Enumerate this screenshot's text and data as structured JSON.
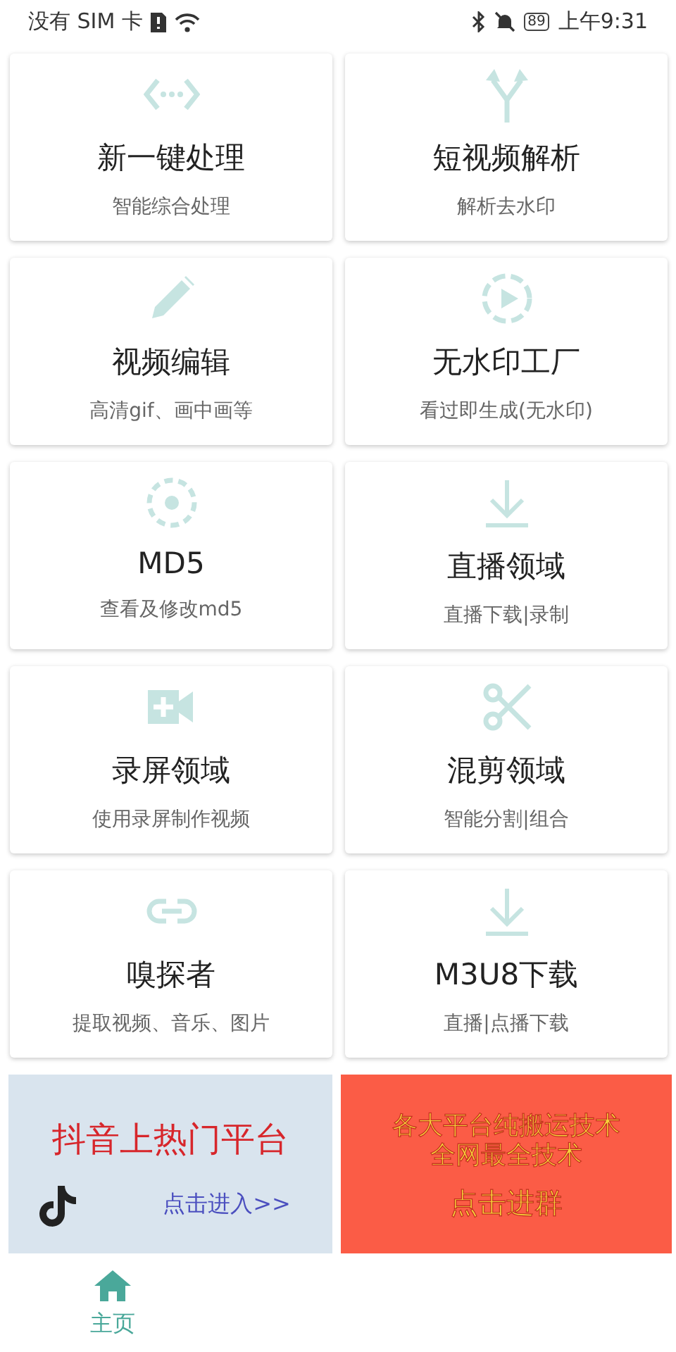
{
  "status_bar": {
    "carrier": "没有 SIM 卡",
    "battery": "89",
    "time": "上午9:31"
  },
  "tools": [
    {
      "title": "新一键处理",
      "subtitle": "智能综合处理"
    },
    {
      "title": "短视频解析",
      "subtitle": "解析去水印"
    },
    {
      "title": "视频编辑",
      "subtitle": "高清gif、画中画等"
    },
    {
      "title": "无水印工厂",
      "subtitle": "看过即生成(无水印)"
    },
    {
      "title": "MD5",
      "subtitle": "查看及修改md5"
    },
    {
      "title": "直播领域",
      "subtitle": "直播下载|录制"
    },
    {
      "title": "录屏领域",
      "subtitle": "使用录屏制作视频"
    },
    {
      "title": "混剪领域",
      "subtitle": "智能分割|组合"
    },
    {
      "title": "嗅探者",
      "subtitle": "提取视频、音乐、图片"
    },
    {
      "title": "M3U8下载",
      "subtitle": "直播|点播下载"
    }
  ],
  "banners": [
    {
      "kind": "platform",
      "title": "抖音上热门平台",
      "action": "点击进入>>"
    },
    {
      "kind": "group",
      "lines": [
        "各大平台纯搬运技术",
        "全网最全技术"
      ],
      "action": "点击进群"
    }
  ],
  "bottom_nav": [
    {
      "label": "主页",
      "selected": true
    }
  ]
}
